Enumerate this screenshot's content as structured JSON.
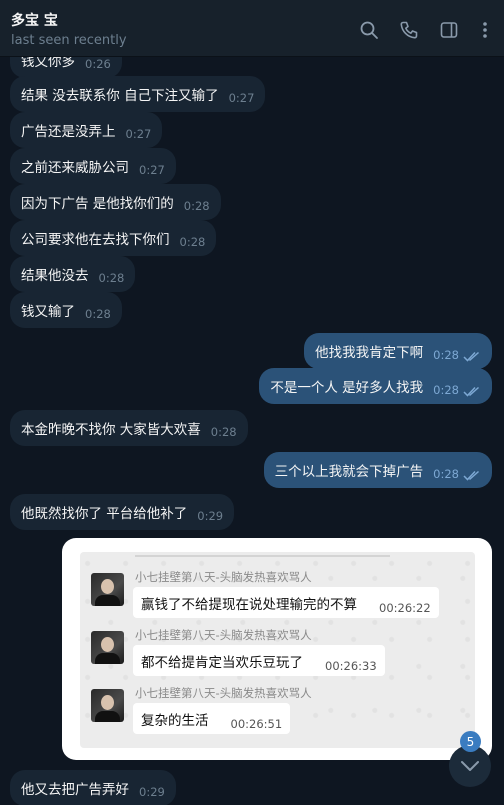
{
  "header": {
    "title": "多宝 宝",
    "status": "last seen recently"
  },
  "messages": [
    {
      "text": "钱又你多",
      "time": "0:26"
    },
    {
      "text": "结果 没去联系你 自己下注又输了",
      "time": "0:27"
    },
    {
      "text": "广告还是没弄上",
      "time": "0:27"
    },
    {
      "text": "之前还来威胁公司",
      "time": "0:27"
    },
    {
      "text": "因为下广告 是他找你们的",
      "time": "0:28"
    },
    {
      "text": "公司要求他在去找下你们",
      "time": "0:28"
    },
    {
      "text": "结果他没去",
      "time": "0:28"
    },
    {
      "text": "钱又输了",
      "time": "0:28"
    },
    {
      "text": "他找我我肯定下啊",
      "time": "0:28"
    },
    {
      "text": "不是一个人 是好多人找我",
      "time": "0:28"
    },
    {
      "text": "本金昨晚不找你 大家皆大欢喜",
      "time": "0:28"
    },
    {
      "text": "三个以上我就会下掉广告",
      "time": "0:28"
    },
    {
      "text": "他既然找你了 平台给他补了",
      "time": "0:29"
    },
    {
      "text": "他又去把广告弄好",
      "time": "0:29"
    }
  ],
  "photo": {
    "items": [
      {
        "name": "小七挂壁第八天-头脑发热喜欢骂人",
        "text": "赢钱了不给提现在说处理输完的不算",
        "time": "00:26:22"
      },
      {
        "name": "小七挂壁第八天-头脑发热喜欢骂人",
        "text": "都不给提肯定当欢乐豆玩了",
        "time": "00:26:33"
      },
      {
        "name": "小七挂壁第八天-头脑发热喜欢骂人",
        "text": "复杂的生活",
        "time": "00:26:51"
      }
    ]
  },
  "unread_count": "5",
  "colors": {
    "incoming": "#182533",
    "outgoing": "#2b5278",
    "background": "#0e1621",
    "accent": "#3a7cc0"
  },
  "icons": [
    "search-icon",
    "phone-icon",
    "sidebar-toggle-icon",
    "more-icon",
    "double-check-icon",
    "chevron-down-icon"
  ]
}
